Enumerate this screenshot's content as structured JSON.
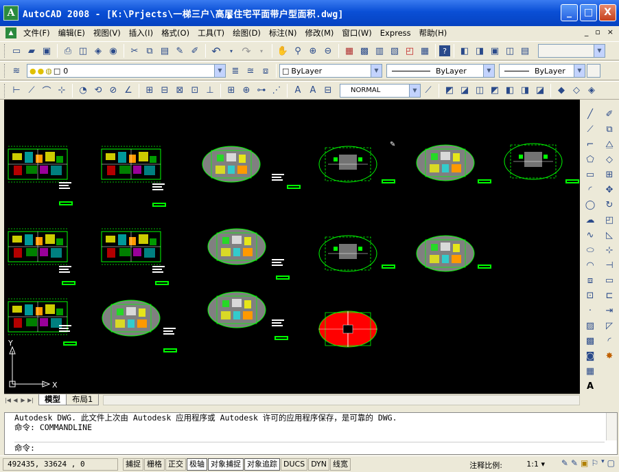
{
  "window": {
    "app_icon": "A",
    "title": "AutoCAD 2008 - [K:\\Prjects\\一梯三户\\高层住宅平面带户型面积.dwg]",
    "min_label": "_",
    "max_label": "□",
    "close_label": "X"
  },
  "menubar": {
    "items": [
      "文件(F)",
      "编辑(E)",
      "视图(V)",
      "插入(I)",
      "格式(O)",
      "工具(T)",
      "绘图(D)",
      "标注(N)",
      "修改(M)",
      "窗口(W)",
      "Express",
      "帮助(H)"
    ],
    "mdi_min": "_",
    "mdi_restore": "▫",
    "mdi_close": "×"
  },
  "layer_toolbar": {
    "layer_value": "0",
    "color_value": "ByLayer",
    "linetype_value": "ByLayer",
    "lineweight_value": "ByLayer"
  },
  "dim_toolbar": {
    "dimstyle_value": "NORMAL"
  },
  "tabs": {
    "model": "模型",
    "layout1": "布局1"
  },
  "ucs": {
    "x_label": "X",
    "y_label": "Y"
  },
  "command": {
    "line1": "Autodesk DWG.   此文件上次由 Autodesk 应用程序或 Autodesk 许可的应用程序保存，是可靠的 DWG.",
    "line2": "命令: COMMANDLINE",
    "prompt": "命令:"
  },
  "status": {
    "coordinates": "492435, 33624  , 0",
    "buttons": [
      "捕捉",
      "栅格",
      "正交",
      "极轴",
      "对象捕捉",
      "对象追踪",
      "DUCS",
      "DYN",
      "线宽"
    ],
    "buttons_on": [
      "极轴",
      "对象捕捉",
      "对象追踪"
    ],
    "annotation_scale_label": "注释比例:",
    "annotation_scale_value": "1:1 ▾"
  },
  "colors": {
    "canvas": "#000000",
    "plan_green": "#00ff00",
    "plan_yellow": "#ffff00",
    "plan_red": "#ff0000",
    "plan_cyan": "#00ffff",
    "plan_gray": "#808080"
  }
}
